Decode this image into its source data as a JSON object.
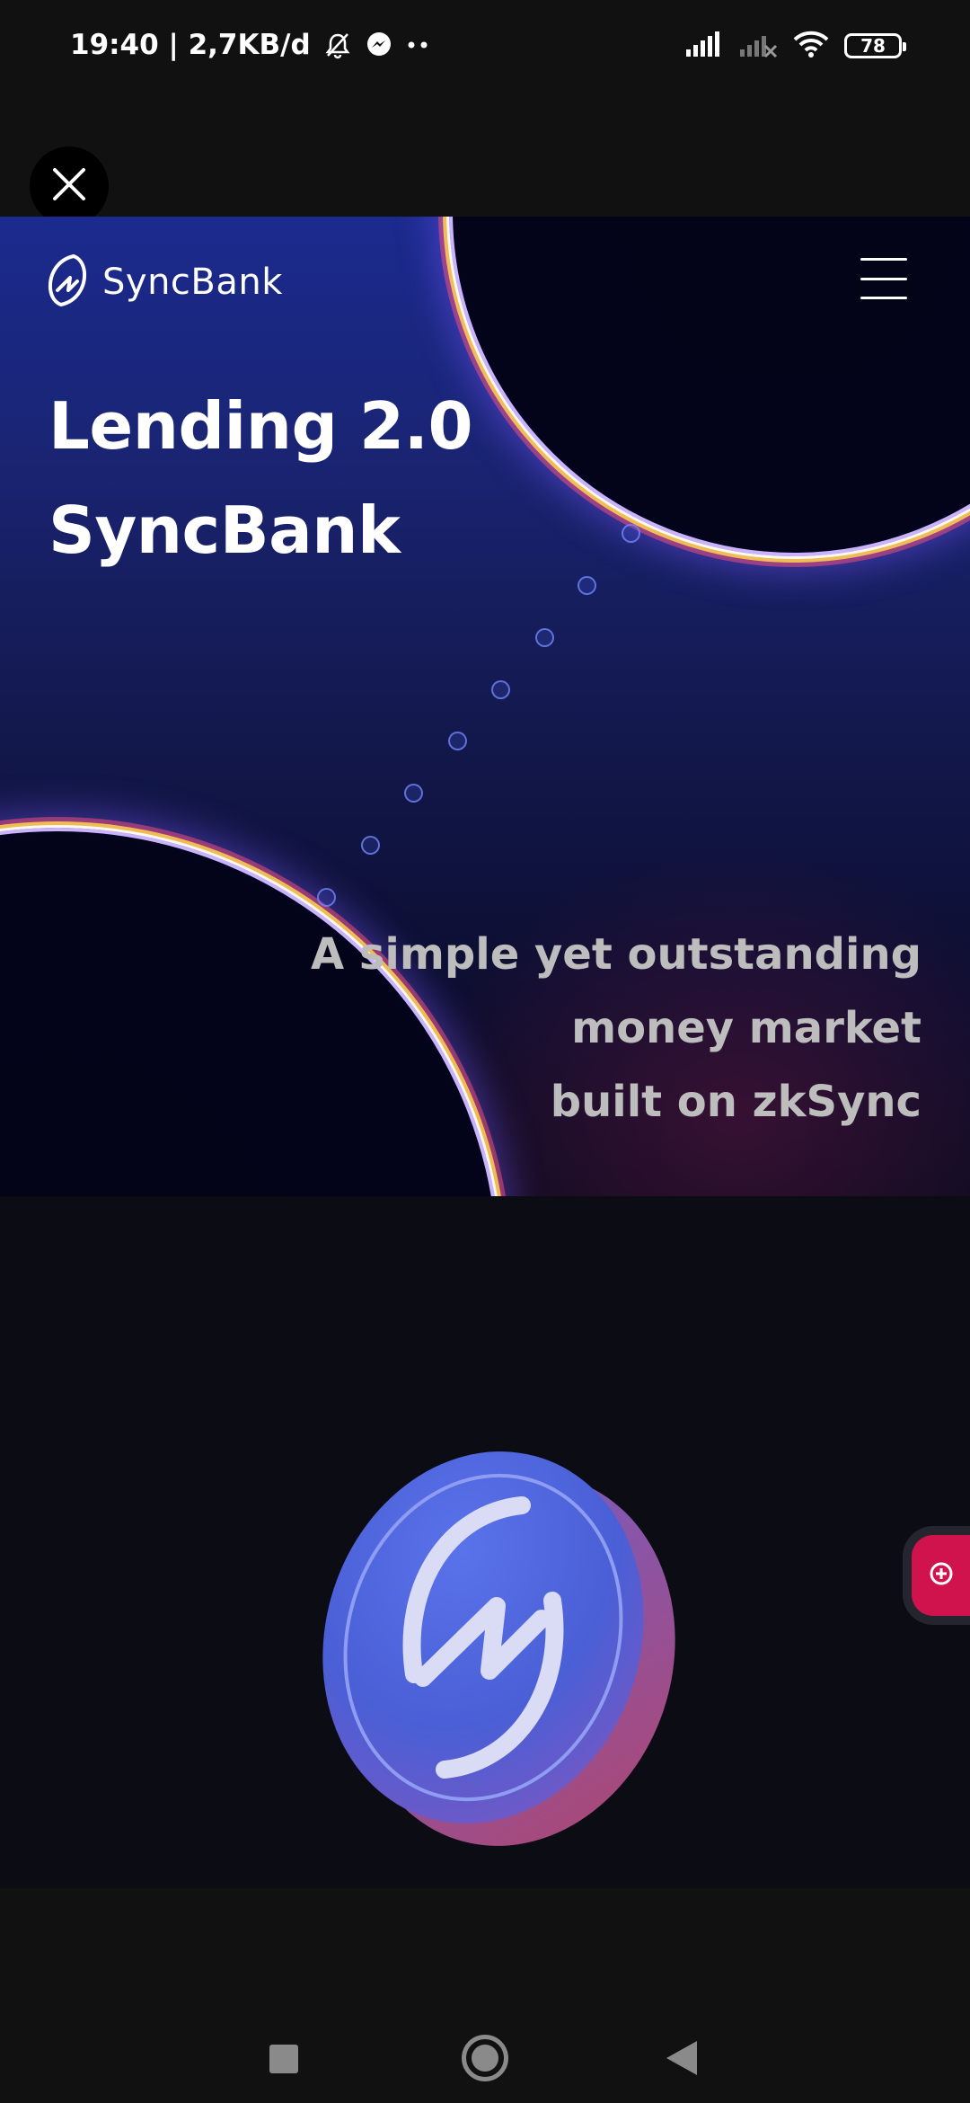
{
  "status_bar": {
    "time_speed": "19:40 | 2,7KB/d",
    "battery": "78",
    "icons": [
      "muted-bell-icon",
      "messenger-icon",
      "more-dots-icon",
      "signal-icon",
      "signal-no-service-icon",
      "wifi-icon",
      "battery-icon"
    ]
  },
  "overlay": {
    "close_icon": "close-icon"
  },
  "site": {
    "brand": "SyncBank",
    "menu_icon": "hamburger-menu-icon",
    "hero_title": [
      "Lending 2.0",
      "SyncBank"
    ],
    "tagline": [
      "A simple yet outstanding",
      "money market",
      "built on zkSync"
    ]
  },
  "coin_section": {
    "coin_icon": "syncbank-coin-icon",
    "chat_icon": "chat-widget-icon"
  },
  "colors": {
    "hero_top": "#1b2a8e",
    "hero_bottom": "#0b0b20",
    "accent_pink": "#d0124d",
    "coin_blue": "#4a5fd6"
  },
  "navigation_bar": {
    "icons": [
      "recents-icon",
      "home-icon",
      "back-icon"
    ]
  }
}
